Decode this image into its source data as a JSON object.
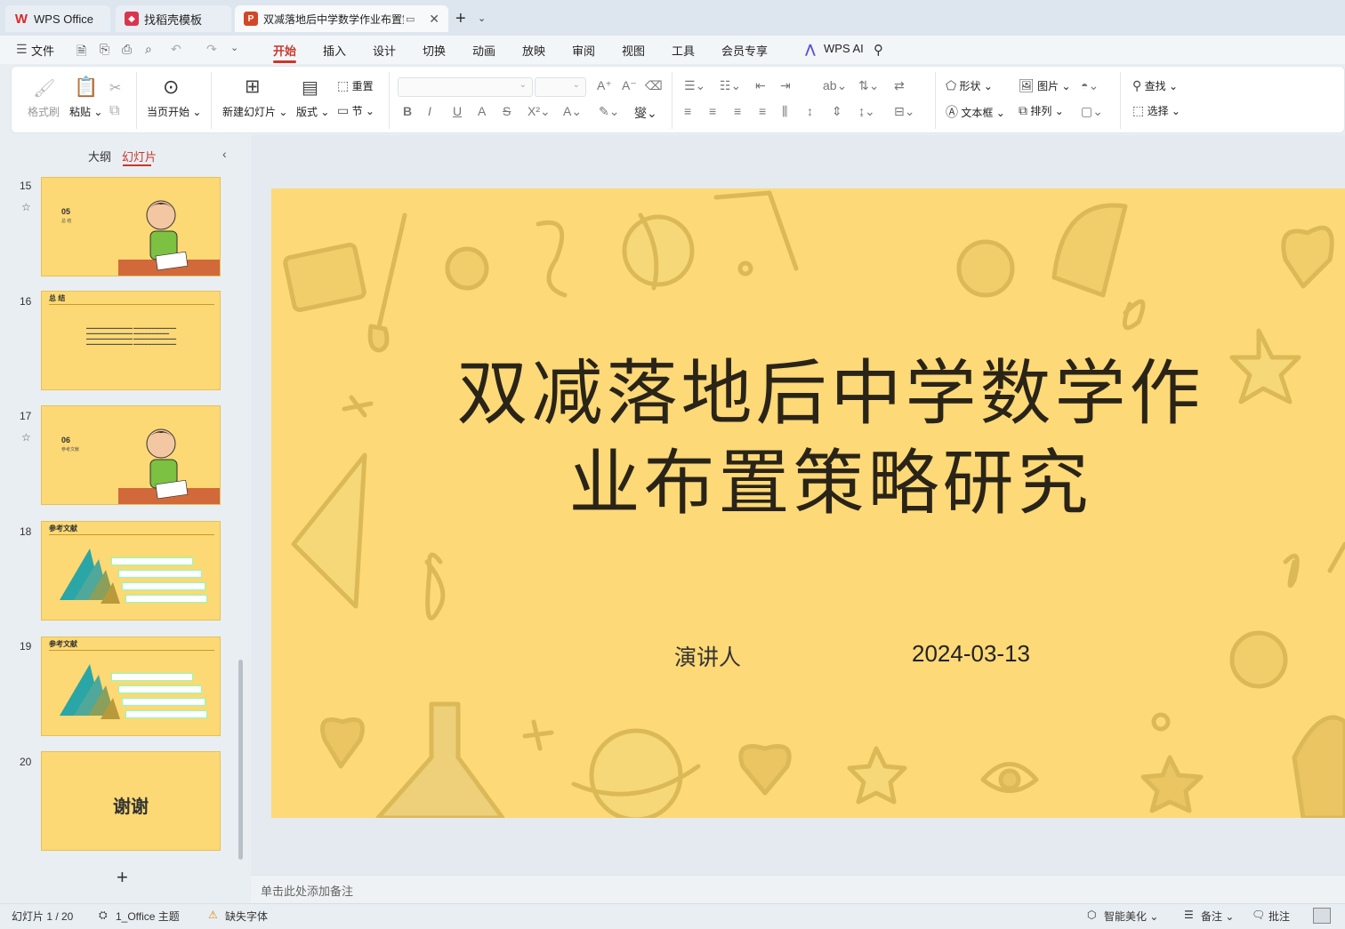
{
  "tabs": {
    "wps": "WPS Office",
    "template": "找稻壳模板",
    "doc": "双减落地后中学数学作业布置策略研究"
  },
  "menu": {
    "file": "文件",
    "items": [
      "开始",
      "插入",
      "设计",
      "切换",
      "动画",
      "放映",
      "审阅",
      "视图",
      "工具",
      "会员专享"
    ],
    "wps_ai": "WPS AI"
  },
  "ribbon": {
    "format_painter": "格式刷",
    "paste": "粘贴",
    "from_current": "当页开始",
    "new_slide": "新建幻灯片",
    "layout": "版式",
    "section": "节",
    "reset": "重置",
    "shape": "形状",
    "picture": "图片",
    "textbox": "文本框",
    "arrange": "排列",
    "find": "查找",
    "select": "选择"
  },
  "panel": {
    "outline": "大纲",
    "slides": "幻灯片",
    "thumbs": [
      {
        "num": "15",
        "label": "05",
        "sub": "总 结"
      },
      {
        "num": "16",
        "label": "总 结"
      },
      {
        "num": "17",
        "label": "06",
        "sub": "参考文献"
      },
      {
        "num": "18",
        "label": "参考文献"
      },
      {
        "num": "19",
        "label": "参考文献"
      },
      {
        "num": "20",
        "label": "谢谢"
      }
    ]
  },
  "slide": {
    "title_line1": "双减落地后中学数学作",
    "title_line2": "业布置策略研究",
    "presenter": "演讲人",
    "date": "2024-03-13"
  },
  "notes": {
    "placeholder": "单击此处添加备注"
  },
  "status": {
    "slide_count": "幻灯片 1 / 20",
    "theme": "1_Office 主题",
    "missing_font": "缺失字体",
    "beautify": "智能美化",
    "notes": "备注",
    "comments": "批注"
  }
}
